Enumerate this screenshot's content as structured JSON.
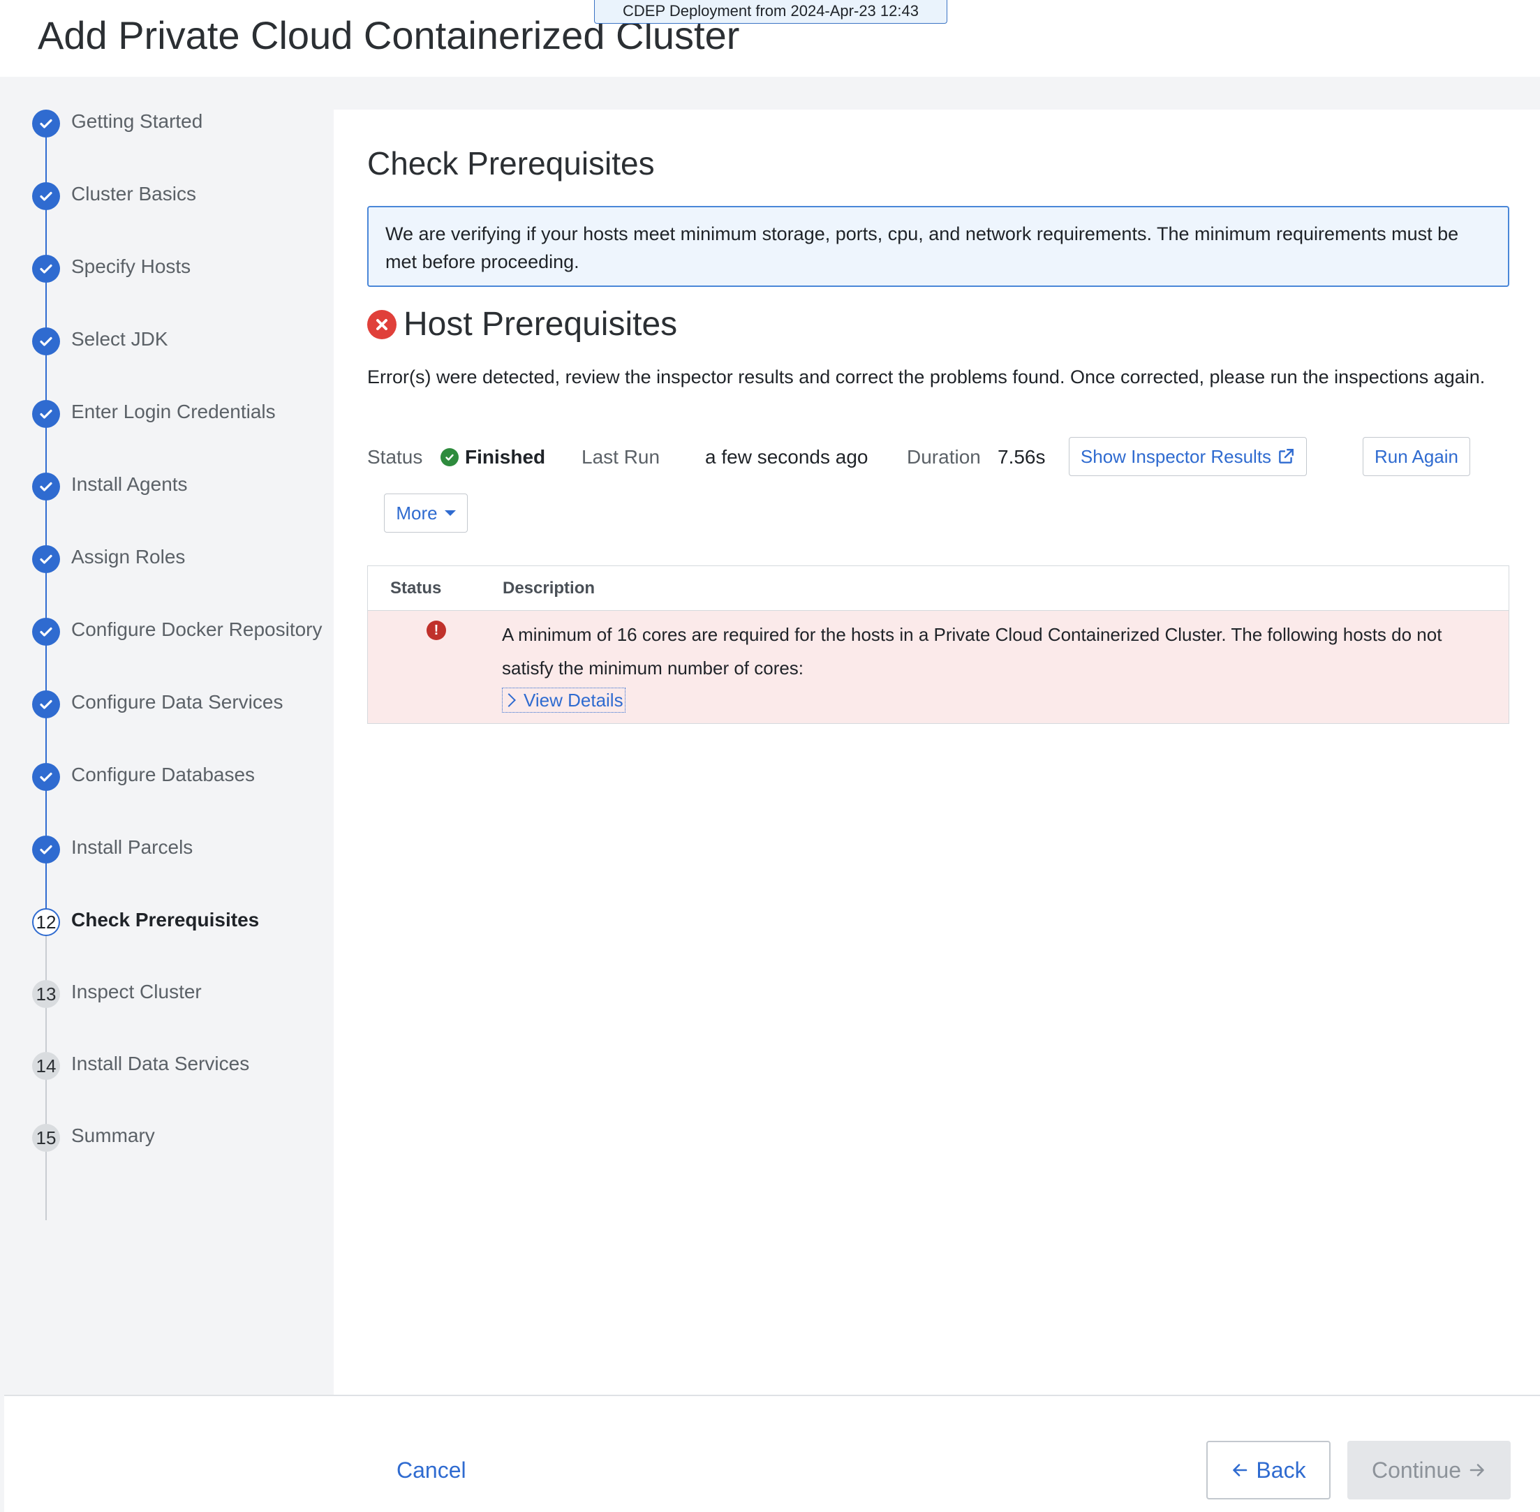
{
  "header": {
    "title": "Add Private Cloud Containerized Cluster",
    "deployment_badge": "CDEP Deployment from 2024-Apr-23 12:43"
  },
  "sidebar": {
    "steps": [
      {
        "label": "Getting Started",
        "state": "done"
      },
      {
        "label": "Cluster Basics",
        "state": "done"
      },
      {
        "label": "Specify Hosts",
        "state": "done"
      },
      {
        "label": "Select JDK",
        "state": "done"
      },
      {
        "label": "Enter Login Credentials",
        "state": "done"
      },
      {
        "label": "Install Agents",
        "state": "done"
      },
      {
        "label": "Assign Roles",
        "state": "done"
      },
      {
        "label": "Configure Docker Repository",
        "state": "done"
      },
      {
        "label": "Configure Data Services",
        "state": "done"
      },
      {
        "label": "Configure Databases",
        "state": "done"
      },
      {
        "label": "Install Parcels",
        "state": "done"
      },
      {
        "number": "12",
        "label": "Check Prerequisites",
        "state": "current"
      },
      {
        "number": "13",
        "label": "Inspect Cluster",
        "state": "todo"
      },
      {
        "number": "14",
        "label": "Install Data Services",
        "state": "todo"
      },
      {
        "number": "15",
        "label": "Summary",
        "state": "todo"
      }
    ]
  },
  "main": {
    "section_title": "Check Prerequisites",
    "info_message": "We are verifying if your hosts meet minimum storage, ports, cpu, and network requirements. The minimum requirements must be met before proceeding.",
    "host_prereq_title": "Host Prerequisites",
    "error_message": "Error(s) were detected, review the inspector results and correct the problems found. Once corrected, please run the inspections again.",
    "status": {
      "status_label": "Status",
      "status_value": "Finished",
      "last_run_label": "Last Run",
      "last_run_value": "a few seconds ago",
      "duration_label": "Duration",
      "duration_value": "7.56s"
    },
    "buttons": {
      "show_inspector": "Show Inspector Results",
      "run_again": "Run Again",
      "more": "More"
    },
    "table": {
      "headers": [
        "Status",
        "Description"
      ],
      "rows": [
        {
          "status": "error",
          "description": "A minimum of 16 cores are required for the hosts in a Private Cloud Containerized Cluster. The following hosts do not satisfy the minimum number of cores:",
          "link": "View Details"
        }
      ]
    }
  },
  "footer": {
    "cancel": "Cancel",
    "back": "Back",
    "continue": "Continue"
  },
  "colors": {
    "accent": "#2f6bd0",
    "error": "#e0403a",
    "success": "#2e8b3d",
    "error_row_bg": "#fbeaea",
    "info_bg": "#eef5fd"
  }
}
